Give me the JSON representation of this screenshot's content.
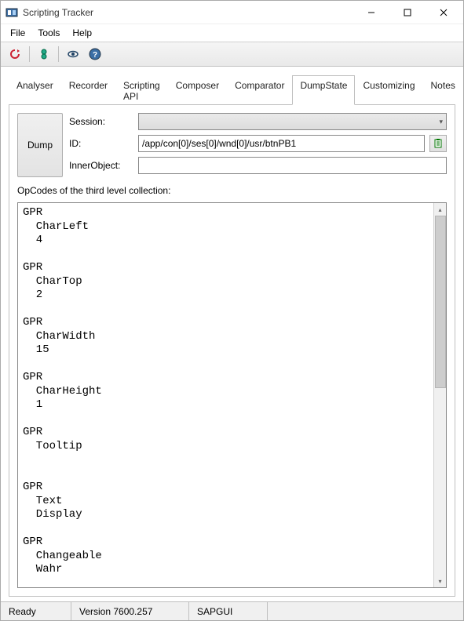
{
  "window": {
    "title": "Scripting Tracker"
  },
  "menu": {
    "items": [
      "File",
      "Tools",
      "Help"
    ]
  },
  "tabs": {
    "items": [
      "Analyser",
      "Recorder",
      "Scripting API",
      "Composer",
      "Comparator",
      "DumpState",
      "Customizing",
      "Notes"
    ],
    "active": "DumpState"
  },
  "dump": {
    "button": "Dump",
    "session_label": "Session:",
    "session_value": "",
    "id_label": "ID:",
    "id_value": "/app/con[0]/ses[0]/wnd[0]/usr/btnPB1",
    "inner_label": "InnerObject:",
    "inner_value": ""
  },
  "opcodes": {
    "label": "OpCodes of the third level collection:",
    "text": "GPR\n  CharLeft\n  4\n\nGPR\n  CharTop\n  2\n\nGPR\n  CharWidth\n  15\n\nGPR\n  CharHeight\n  1\n\nGPR\n  Tooltip\n\n\nGPR\n  Text\n  Display\n\nGPR\n  Changeable\n  Wahr\n"
  },
  "status": {
    "ready": "Ready",
    "version": "Version 7600.257",
    "gui": "SAPGUI"
  }
}
